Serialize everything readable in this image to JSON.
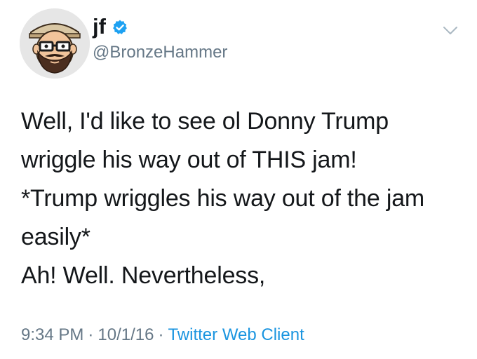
{
  "user": {
    "display_name": "jf",
    "handle": "@BronzeHammer",
    "verified": true,
    "verified_color": "#1da1f2"
  },
  "tweet": {
    "lines": [
      "Well, I'd like to see ol Donny Trump",
      "wriggle his way out of THIS jam!",
      "*Trump wriggles his way out of the jam",
      "easily*",
      "Ah! Well. Nevertheless,"
    ]
  },
  "meta": {
    "time": "9:34 PM",
    "separator": "·",
    "date": "10/1/16",
    "client": "Twitter Web Client"
  },
  "colors": {
    "text": "#14171a",
    "secondary": "#657786",
    "link": "#1b95e0"
  },
  "icons": {
    "avatar": "bearded-man-cartoon-avatar",
    "verified": "verified-badge-icon",
    "menu": "chevron-down-icon"
  }
}
